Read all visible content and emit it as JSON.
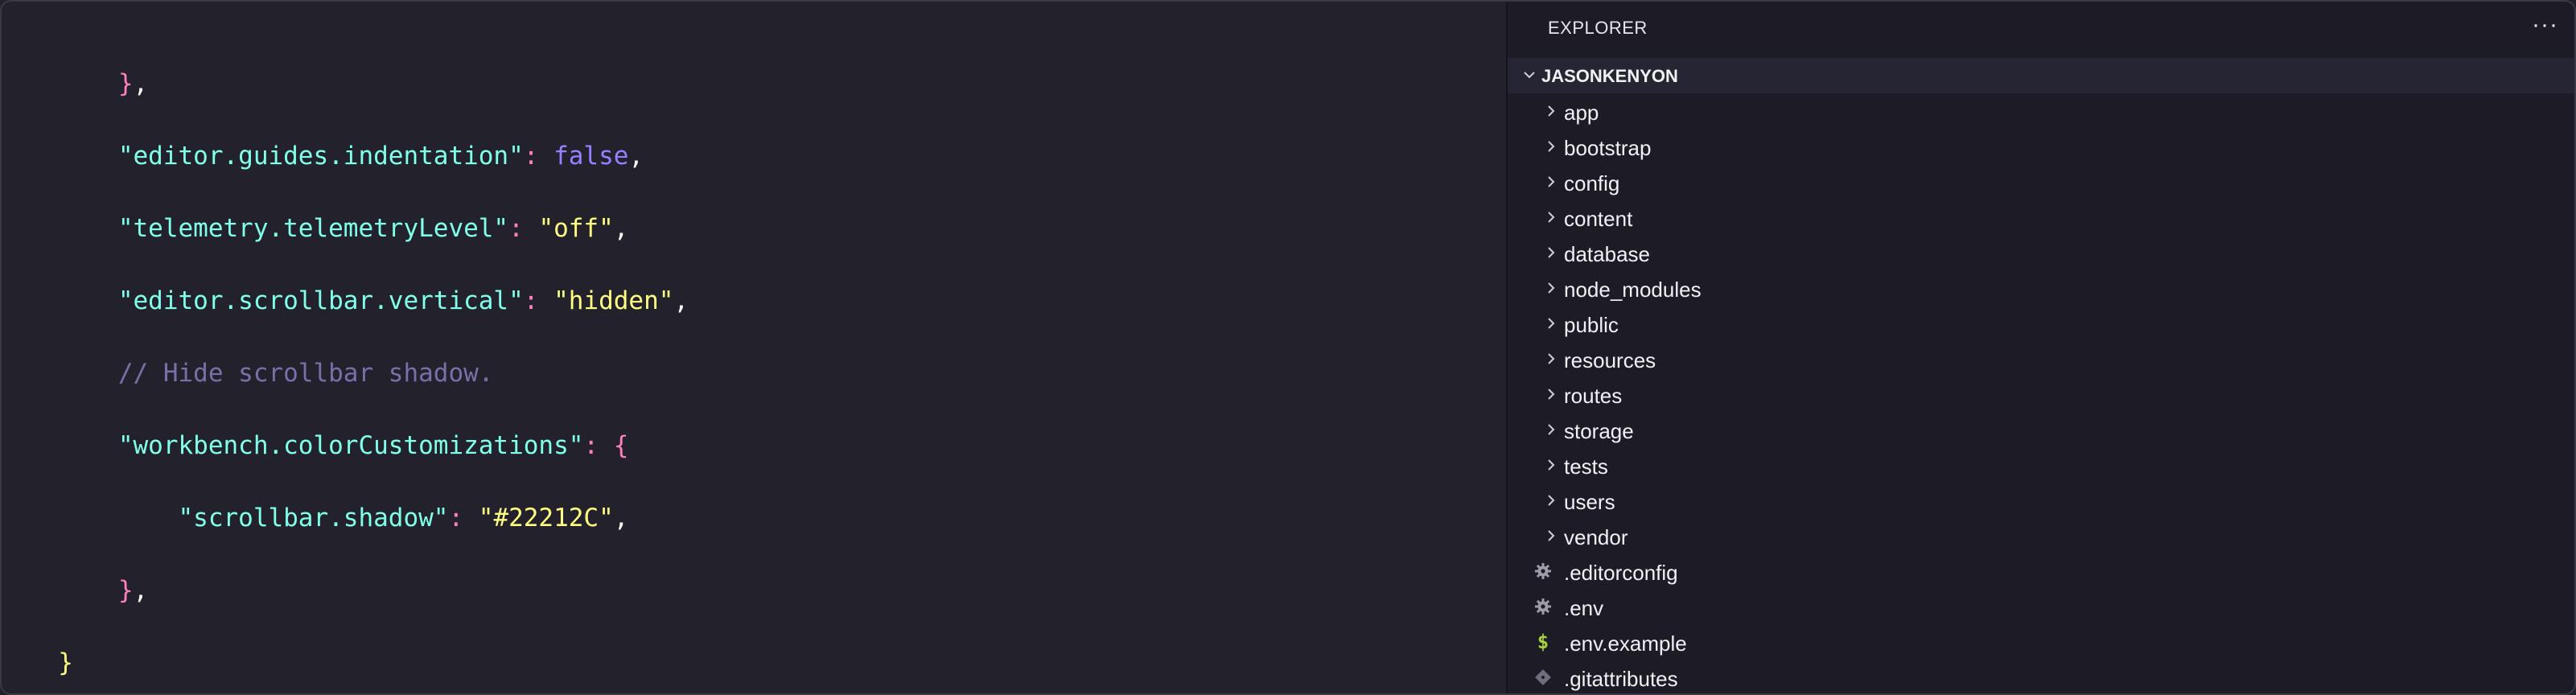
{
  "editor": {
    "lines": [
      [
        {
          "t": "    ",
          "c": "tok-punct"
        },
        {
          "t": "}",
          "c": "tok-brace-pink"
        },
        {
          "t": ",",
          "c": "tok-punct"
        }
      ],
      [
        {
          "t": "    ",
          "c": "tok-punct"
        },
        {
          "t": "\"editor.guides.indentation\"",
          "c": "tok-key"
        },
        {
          "t": ": ",
          "c": "tok-colon"
        },
        {
          "t": "false",
          "c": "tok-bool"
        },
        {
          "t": ",",
          "c": "tok-punct"
        }
      ],
      [
        {
          "t": "    ",
          "c": "tok-punct"
        },
        {
          "t": "\"telemetry.telemetryLevel\"",
          "c": "tok-key"
        },
        {
          "t": ": ",
          "c": "tok-colon"
        },
        {
          "t": "\"off\"",
          "c": "tok-str"
        },
        {
          "t": ",",
          "c": "tok-punct"
        }
      ],
      [
        {
          "t": "    ",
          "c": "tok-punct"
        },
        {
          "t": "\"editor.scrollbar.vertical\"",
          "c": "tok-key"
        },
        {
          "t": ": ",
          "c": "tok-colon"
        },
        {
          "t": "\"hidden\"",
          "c": "tok-str"
        },
        {
          "t": ",",
          "c": "tok-punct"
        }
      ],
      [
        {
          "t": "    ",
          "c": "tok-punct"
        },
        {
          "t": "// Hide scrollbar shadow.",
          "c": "tok-comment"
        }
      ],
      [
        {
          "t": "    ",
          "c": "tok-punct"
        },
        {
          "t": "\"workbench.colorCustomizations\"",
          "c": "tok-key"
        },
        {
          "t": ": ",
          "c": "tok-colon"
        },
        {
          "t": "{",
          "c": "tok-brace-pink"
        }
      ],
      [
        {
          "t": "        ",
          "c": "tok-punct"
        },
        {
          "t": "\"scrollbar.shadow\"",
          "c": "tok-key"
        },
        {
          "t": ": ",
          "c": "tok-colon"
        },
        {
          "t": "\"#22212C\"",
          "c": "tok-str"
        },
        {
          "t": ",",
          "c": "tok-punct"
        }
      ],
      [
        {
          "t": "    ",
          "c": "tok-punct"
        },
        {
          "t": "}",
          "c": "tok-brace-pink"
        },
        {
          "t": ",",
          "c": "tok-punct"
        }
      ],
      [
        {
          "t": "}",
          "c": "tok-brace-yellow"
        }
      ]
    ]
  },
  "sidebar": {
    "title": "EXPLORER",
    "more_label": "···",
    "section": "JASONKENYON",
    "folders": [
      "app",
      "bootstrap",
      "config",
      "content",
      "database",
      "node_modules",
      "public",
      "resources",
      "routes",
      "storage",
      "tests",
      "users",
      "vendor"
    ],
    "files": [
      {
        "name": ".editorconfig",
        "icon": "gear-icon"
      },
      {
        "name": ".env",
        "icon": "gear-icon"
      },
      {
        "name": ".env.example",
        "icon": "dollar-icon"
      },
      {
        "name": ".gitattributes",
        "icon": "git-icon"
      }
    ]
  },
  "colors": {
    "background": "#22212c",
    "sidebar": "#1d1c26",
    "key": "#80ffea",
    "string": "#ffff80",
    "boolean": "#9580ff",
    "punctuation_pink": "#ff80bf",
    "comment": "#7970a9"
  }
}
